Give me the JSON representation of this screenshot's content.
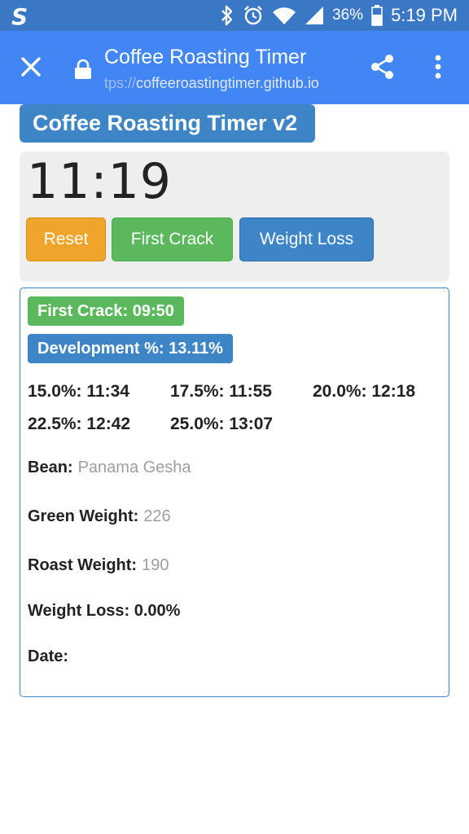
{
  "status_bar": {
    "carrier_logo": "S",
    "battery_percent": "36%",
    "time": "5:19 PM",
    "icons": [
      "bluetooth-icon",
      "alarm-icon",
      "wifi-icon",
      "signal-icon",
      "battery-icon"
    ]
  },
  "toolbar": {
    "title": "Coffee Roasting Timer",
    "url_scheme": "tps://",
    "url_host": "coffeeroastingtimer.github.io"
  },
  "app": {
    "title": "Coffee Roasting Timer v2",
    "timer": "11:19",
    "buttons": {
      "reset": "Reset",
      "first_crack": "First Crack",
      "weight_loss": "Weight Loss"
    },
    "first_crack_badge": "First Crack: 09:50",
    "development_badge": "Development %: 13.11%",
    "targets": [
      "15.0%: 11:34",
      "17.5%: 11:55",
      "20.0%: 12:18",
      "22.5%: 12:42",
      "25.0%: 13:07"
    ],
    "fields": {
      "bean_label": "Bean:",
      "bean_value": "Panama Gesha",
      "green_weight_label": "Green Weight:",
      "green_weight_value": "226",
      "roast_weight_label": "Roast Weight:",
      "roast_weight_value": "190",
      "weight_loss_text": "Weight Loss: 0.00%",
      "date_label": "Date:"
    }
  },
  "colors": {
    "status_bar": "#3a77c4",
    "toolbar": "#4285f4",
    "primary": "#3d85c6",
    "success": "#5cb85c",
    "warning": "#efa42b"
  }
}
